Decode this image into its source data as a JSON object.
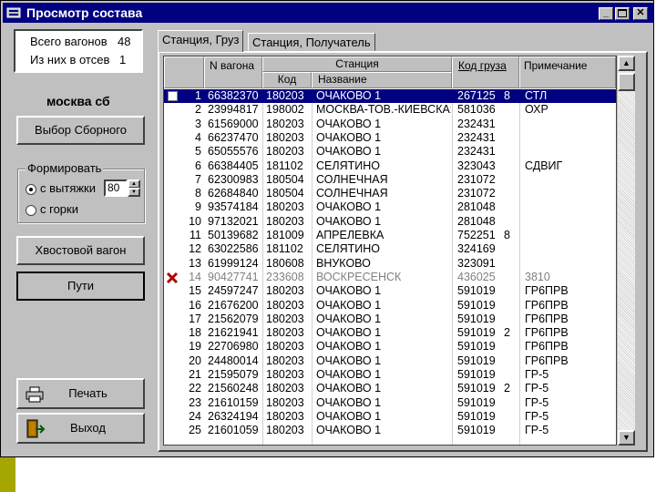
{
  "window": {
    "title": "Просмотр состава"
  },
  "counts": {
    "total_label": "Всего вагонов",
    "total_value": "48",
    "drop_label": "Из них в отсев",
    "drop_value": "1"
  },
  "station_name": "москва сб",
  "buttons": {
    "select_combined": "Выбор Сборного",
    "tail_wagon": "Хвостовой вагон",
    "tracks": "Пути",
    "print": "Печать",
    "exit": "Выход"
  },
  "form_group": {
    "title": "Формировать",
    "opt_pull": "с вытяжки",
    "pull_value": "80",
    "opt_hill": "с горки"
  },
  "tabs": [
    "Станция, Груз",
    "Станция, Получатель"
  ],
  "table": {
    "headers": {
      "wagon_no": "N вагона",
      "station": "Станция",
      "code": "Код",
      "name": "Название",
      "cargo_code": "Код груза",
      "note": "Примечание"
    },
    "rows": [
      {
        "n": "1",
        "wagon": "66382370",
        "code": "180203",
        "name": "ОЧАКОВО 1",
        "cargo": "267125",
        "q": "8",
        "note": "СТЛ",
        "state": "selected"
      },
      {
        "n": "2",
        "wagon": "23994817",
        "code": "198002",
        "name": "МОСКВА-ТОВ.-КИЕВСКАЯ",
        "cargo": "581036",
        "q": "",
        "note": "ОХР",
        "state": ""
      },
      {
        "n": "3",
        "wagon": "61569000",
        "code": "180203",
        "name": "ОЧАКОВО 1",
        "cargo": "232431",
        "q": "",
        "note": "",
        "state": ""
      },
      {
        "n": "4",
        "wagon": "66237470",
        "code": "180203",
        "name": "ОЧАКОВО 1",
        "cargo": "232431",
        "q": "",
        "note": "",
        "state": ""
      },
      {
        "n": "5",
        "wagon": "65055576",
        "code": "180203",
        "name": "ОЧАКОВО 1",
        "cargo": "232431",
        "q": "",
        "note": "",
        "state": ""
      },
      {
        "n": "6",
        "wagon": "66384405",
        "code": "181102",
        "name": "СЕЛЯТИНО",
        "cargo": "323043",
        "q": "",
        "note": "СДВИГ",
        "state": ""
      },
      {
        "n": "7",
        "wagon": "62300983",
        "code": "180504",
        "name": "СОЛНЕЧНАЯ",
        "cargo": "231072",
        "q": "",
        "note": "",
        "state": ""
      },
      {
        "n": "8",
        "wagon": "62684840",
        "code": "180504",
        "name": "СОЛНЕЧНАЯ",
        "cargo": "231072",
        "q": "",
        "note": "",
        "state": ""
      },
      {
        "n": "9",
        "wagon": "93574184",
        "code": "180203",
        "name": "ОЧАКОВО 1",
        "cargo": "281048",
        "q": "",
        "note": "",
        "state": ""
      },
      {
        "n": "10",
        "wagon": "97132021",
        "code": "180203",
        "name": "ОЧАКОВО 1",
        "cargo": "281048",
        "q": "",
        "note": "",
        "state": ""
      },
      {
        "n": "11",
        "wagon": "50139682",
        "code": "181009",
        "name": "АПРЕЛЕВКА",
        "cargo": "752251",
        "q": "8",
        "note": "",
        "state": ""
      },
      {
        "n": "12",
        "wagon": "63022586",
        "code": "181102",
        "name": "СЕЛЯТИНО",
        "cargo": "324169",
        "q": "",
        "note": "",
        "state": ""
      },
      {
        "n": "13",
        "wagon": "61999124",
        "code": "180608",
        "name": "ВНУКОВО",
        "cargo": "323091",
        "q": "",
        "note": "",
        "state": ""
      },
      {
        "n": "14",
        "wagon": "90427741",
        "code": "233608",
        "name": "ВОСКРЕСЕНСК",
        "cargo": "436025",
        "q": "",
        "note": "3810",
        "state": "removed"
      },
      {
        "n": "15",
        "wagon": "24597247",
        "code": "180203",
        "name": "ОЧАКОВО 1",
        "cargo": "591019",
        "q": "",
        "note": "ГР6ПРВ",
        "state": ""
      },
      {
        "n": "16",
        "wagon": "21676200",
        "code": "180203",
        "name": "ОЧАКОВО 1",
        "cargo": "591019",
        "q": "",
        "note": "ГР6ПРВ",
        "state": ""
      },
      {
        "n": "17",
        "wagon": "21562079",
        "code": "180203",
        "name": "ОЧАКОВО 1",
        "cargo": "591019",
        "q": "",
        "note": "ГР6ПРВ",
        "state": ""
      },
      {
        "n": "18",
        "wagon": "21621941",
        "code": "180203",
        "name": "ОЧАКОВО 1",
        "cargo": "591019",
        "q": "2",
        "note": "ГР6ПРВ",
        "state": ""
      },
      {
        "n": "19",
        "wagon": "22706980",
        "code": "180203",
        "name": "ОЧАКОВО 1",
        "cargo": "591019",
        "q": "",
        "note": "ГР6ПРВ",
        "state": ""
      },
      {
        "n": "20",
        "wagon": "24480014",
        "code": "180203",
        "name": "ОЧАКОВО 1",
        "cargo": "591019",
        "q": "",
        "note": "ГР6ПРВ",
        "state": ""
      },
      {
        "n": "21",
        "wagon": "21595079",
        "code": "180203",
        "name": "ОЧАКОВО 1",
        "cargo": "591019",
        "q": "",
        "note": "ГР-5",
        "state": ""
      },
      {
        "n": "22",
        "wagon": "21560248",
        "code": "180203",
        "name": "ОЧАКОВО 1",
        "cargo": "591019",
        "q": "2",
        "note": "ГР-5",
        "state": ""
      },
      {
        "n": "23",
        "wagon": "21610159",
        "code": "180203",
        "name": "ОЧАКОВО 1",
        "cargo": "591019",
        "q": "",
        "note": "ГР-5",
        "state": ""
      },
      {
        "n": "24",
        "wagon": "26324194",
        "code": "180203",
        "name": "ОЧАКОВО 1",
        "cargo": "591019",
        "q": "",
        "note": "ГР-5",
        "state": ""
      },
      {
        "n": "25",
        "wagon": "21601059",
        "code": "180203",
        "name": "ОЧАКОВО 1",
        "cargo": "591019",
        "q": "",
        "note": "ГР-5",
        "state": ""
      }
    ]
  },
  "colors": {
    "titlebar": "#000080",
    "selection": "#000080",
    "removed_mark": "#b00000",
    "accent_bar": "#a6a600"
  }
}
